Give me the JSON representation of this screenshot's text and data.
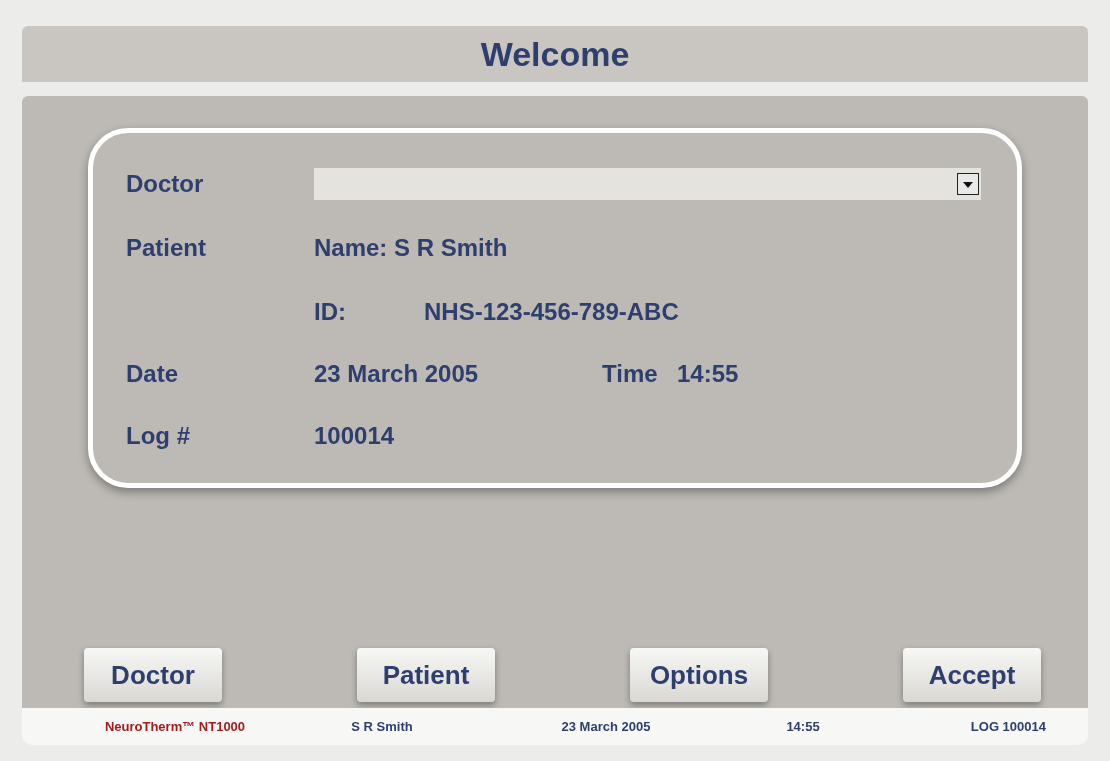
{
  "title": "Welcome",
  "form": {
    "doctor": {
      "label": "Doctor"
    },
    "patient": {
      "label": "Patient",
      "name": "Name: S R Smith",
      "id_label": "ID:",
      "id": "NHS-123-456-789-ABC"
    },
    "date": {
      "label": "Date",
      "value": "23 March 2005",
      "time_label": "Time",
      "time": "14:55"
    },
    "log": {
      "label": "Log #",
      "value": "100014"
    }
  },
  "buttons": [
    "Doctor",
    "Patient",
    "Options",
    "Accept"
  ],
  "status_bar": [
    {
      "kind": "brand",
      "text": "NeuroTherm™ NT1000"
    },
    {
      "kind": "info",
      "text": "S R Smith"
    },
    {
      "kind": "info",
      "text": "23 March 2005"
    },
    {
      "kind": "info",
      "text": "14:55"
    },
    {
      "kind": "info",
      "text": "LOG 100014"
    }
  ]
}
